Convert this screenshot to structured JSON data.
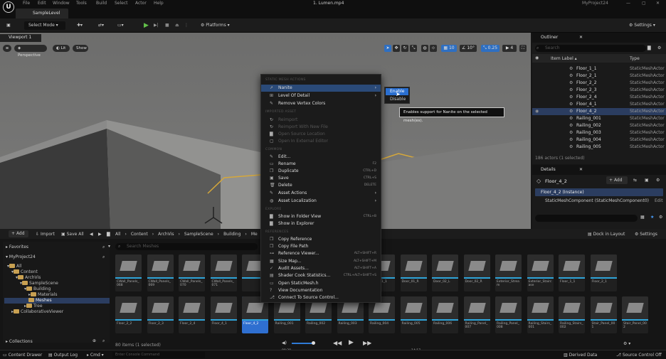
{
  "window": {
    "title": "1. Lumen.mp4",
    "project": "MyProject24"
  },
  "menu": [
    "File",
    "Edit",
    "Window",
    "Tools",
    "Build",
    "Select",
    "Actor",
    "Help"
  ],
  "level_tab": "SampleLevel",
  "toolbar": {
    "select_mode": "Select Mode",
    "platforms": "Platforms",
    "settings": "Settings"
  },
  "viewport": {
    "tab": "Viewport 1",
    "perspective": "Perspective",
    "lit": "Lit",
    "show": "Show",
    "grid": "10",
    "angle": "10°",
    "scale": "0.25",
    "speed": "4"
  },
  "outliner": {
    "title": "Outliner",
    "search_placeholder": "Search",
    "col_label": "Item Label",
    "col_type": "Type",
    "rows": [
      {
        "label": "Floor_1_1",
        "type": "StaticMeshActor"
      },
      {
        "label": "Floor_2_1",
        "type": "StaticMeshActor"
      },
      {
        "label": "Floor_2_2",
        "type": "StaticMeshActor"
      },
      {
        "label": "Floor_2_3",
        "type": "StaticMeshActor"
      },
      {
        "label": "Floor_2_4",
        "type": "StaticMeshActor"
      },
      {
        "label": "Floor_4_1",
        "type": "StaticMeshActor"
      },
      {
        "label": "Floor_4_2",
        "type": "StaticMeshActor"
      },
      {
        "label": "Railing_001",
        "type": "StaticMeshActor"
      },
      {
        "label": "Railing_002",
        "type": "StaticMeshActor"
      },
      {
        "label": "Railing_003",
        "type": "StaticMeshActor"
      },
      {
        "label": "Railing_004",
        "type": "StaticMeshActor"
      },
      {
        "label": "Railing_005",
        "type": "StaticMeshActor"
      }
    ],
    "count": "186 actors (1 selected)"
  },
  "details": {
    "title": "Details",
    "object": "Floor_4_2",
    "add": "Add",
    "instance": "Floor_4_2 (Instance)",
    "component": "StaticMeshComponent (StaticMeshComponent0)",
    "edit": "Edit"
  },
  "content": {
    "add": "Add",
    "import": "Import",
    "save_all": "Save All",
    "breadcrumb": [
      "All",
      "Content",
      "ArchVis",
      "SampleScene",
      "Building",
      "Me"
    ],
    "dock": "Dock in Layout",
    "settings": "Settings",
    "favorites": "Favorites",
    "project": "MyProject24",
    "search_placeholder": "Search Meshes",
    "tree": [
      "All",
      "Content",
      "ArchVis",
      "SampleScene",
      "Building",
      "Materials",
      "Meshes",
      "Tree",
      "CollaborativeViewer"
    ],
    "collections": "Collections",
    "status": "80 items (1 selected)",
    "row1": [
      "CWall_Panels_068",
      "CWall_Panels_069",
      "CWall_Panels_070",
      "CWall_Panels_071",
      "",
      "",
      "",
      "",
      "Door_01_1",
      "Door_01_R",
      "Door_02_L",
      "Door_02_R",
      "Exterior_Stream",
      "Exterior_Staircase",
      "Floor_1_1",
      "Floor_2_1"
    ],
    "row2": [
      "Floor_2_2",
      "Floor_2_3",
      "Floor_2_4",
      "Floor_4_1",
      "Floor_4_2",
      "Railing_001",
      "Railing_002",
      "Railing_003",
      "Railing_004",
      "Railing_005",
      "Railing_006",
      "Railing_Panel_007",
      "Railing_Panel_008",
      "Railing_Stairs_001",
      "Railing_Stairs_002",
      "Stair_Panel_001",
      "Stair_Panel_002"
    ]
  },
  "player": {
    "current": "00:30",
    "total": "14:17"
  },
  "statusbar": {
    "drawer": "Content Drawer",
    "log": "Output Log",
    "cmd": "Cmd",
    "console": "Enter Console Command",
    "derived": "Derived Data",
    "source": "Source Control Off"
  },
  "context_menu": {
    "header": "STATIC MESH ACTIONS",
    "nanite": "Nanite",
    "lod": "Level Of Detail",
    "remove_colors": "Remove Vertex Colors",
    "imported_sec": "IMPORTED ASSET",
    "reimport": "Reimport",
    "reimport_file": "Reimport With New File",
    "open_source": "Open Source Location",
    "open_external": "Open In External Editor",
    "common_sec": "COMMON",
    "edit": "Edit...",
    "rename": "Rename",
    "rename_sc": "F2",
    "duplicate": "Duplicate",
    "duplicate_sc": "CTRL+D",
    "save": "Save",
    "save_sc": "CTRL+S",
    "delete": "Delete",
    "delete_sc": "DELETE",
    "asset_actions": "Asset Actions",
    "asset_loc": "Asset Localization",
    "explore_sec": "EXPLORE",
    "show_folder": "Show in Folder View",
    "show_folder_sc": "CTRL+B",
    "show_explorer": "Show in Explorer",
    "refs_sec": "REFERENCES",
    "copy_ref": "Copy Reference",
    "copy_path": "Copy File Path",
    "ref_viewer": "Reference Viewer...",
    "ref_viewer_sc": "ALT+SHIFT+R",
    "size_map": "Size Map...",
    "size_map_sc": "ALT+SHIFT+M",
    "audit": "Audit Assets...",
    "audit_sc": "ALT+SHIFT+A",
    "shader_stats": "Shader Cook Statistics...",
    "shader_stats_sc": "CTRL+ALT+SHIFT+S",
    "open_sm": "Open StaticMesh.h",
    "docs": "View Documentation",
    "source_ctrl": "Connect To Source Control..."
  },
  "submenu": {
    "enable": "Enable",
    "disable": "Disable"
  },
  "tooltip": "Enables support for Nanite on the selected mesh(es)."
}
